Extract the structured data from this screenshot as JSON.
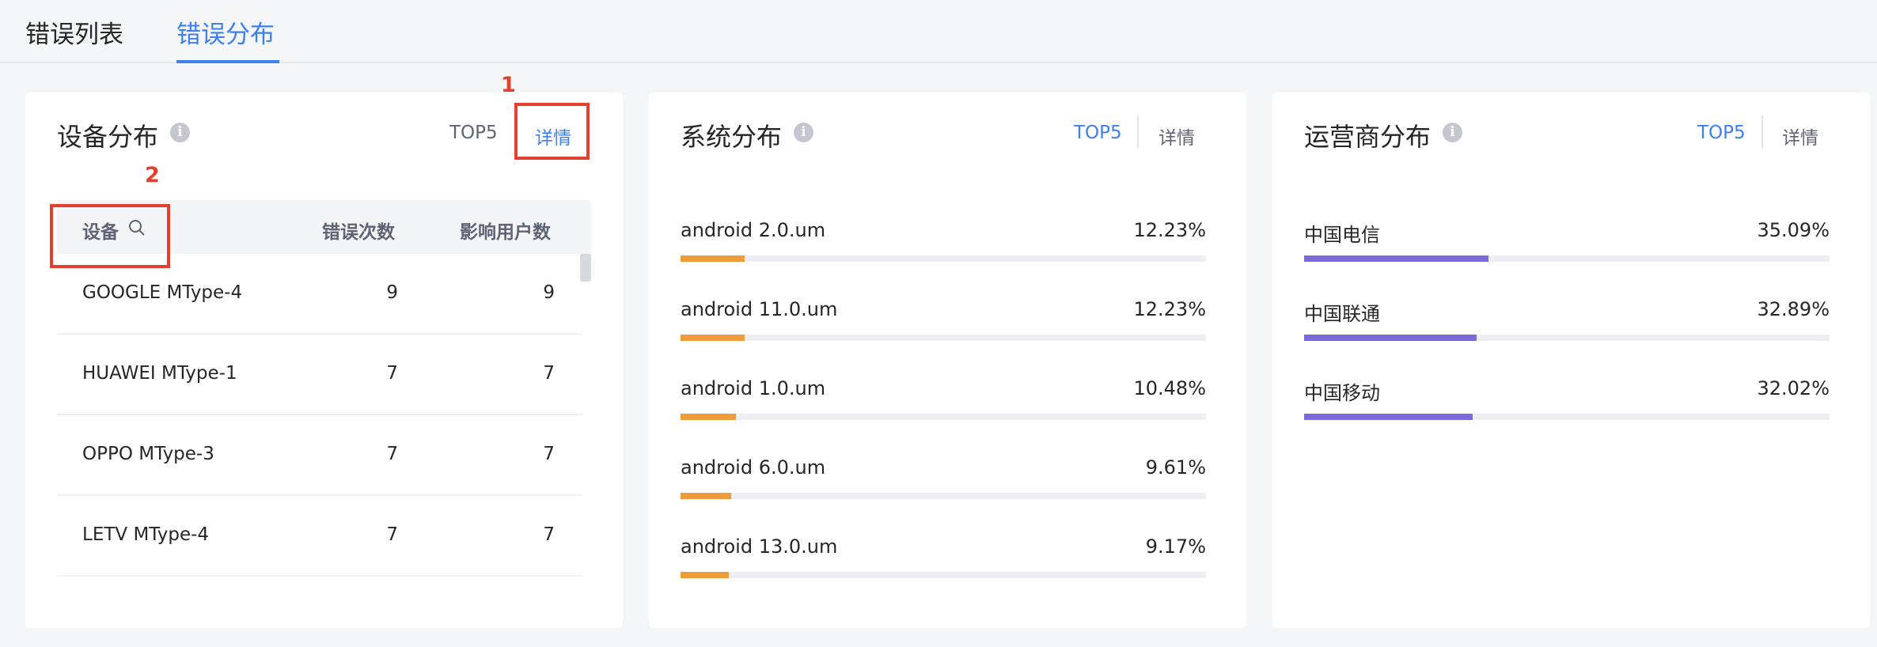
{
  "tabs": [
    {
      "label": "错误列表",
      "active": false
    },
    {
      "label": "错误分布",
      "active": true
    }
  ],
  "annotations": [
    "1",
    "2"
  ],
  "device_card": {
    "title": "设备分布",
    "top5": "TOP5",
    "detail": "详情",
    "columns": [
      "设备",
      "错误次数",
      "影响用户数"
    ],
    "rows": [
      {
        "device": "GOOGLE MType-4",
        "errors": "9",
        "users": "9"
      },
      {
        "device": "HUAWEI MType-1",
        "errors": "7",
        "users": "7"
      },
      {
        "device": "OPPO MType-3",
        "errors": "7",
        "users": "7"
      },
      {
        "device": "LETV MType-4",
        "errors": "7",
        "users": "7"
      }
    ]
  },
  "system_card": {
    "title": "系统分布",
    "top5": "TOP5",
    "detail": "详情",
    "bar_color": "#ee9b3a",
    "items": [
      {
        "label": "android 2.0.um",
        "pct": "12.23%",
        "value": 12.23
      },
      {
        "label": "android 11.0.um",
        "pct": "12.23%",
        "value": 12.23
      },
      {
        "label": "android 1.0.um",
        "pct": "10.48%",
        "value": 10.48
      },
      {
        "label": "android 6.0.um",
        "pct": "9.61%",
        "value": 9.61
      },
      {
        "label": "android 13.0.um",
        "pct": "9.17%",
        "value": 9.17
      }
    ]
  },
  "carrier_card": {
    "title": "运营商分布",
    "top5": "TOP5",
    "detail": "详情",
    "bar_color": "#7b6bd6",
    "items": [
      {
        "label": "中国电信",
        "pct": "35.09%",
        "value": 35.09
      },
      {
        "label": "中国联通",
        "pct": "32.89%",
        "value": 32.89
      },
      {
        "label": "中国移动",
        "pct": "32.02%",
        "value": 32.02
      }
    ]
  }
}
